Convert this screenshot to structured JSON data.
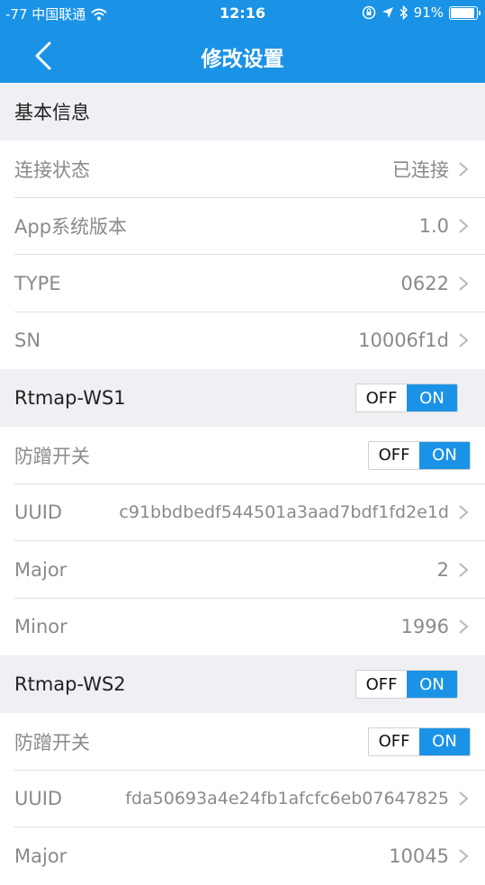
{
  "status_bar": {
    "carrier": "-77 中国联通",
    "time": "12:16",
    "battery": "91%"
  },
  "nav": {
    "title": "修改设置"
  },
  "sections": {
    "basic": "基本信息",
    "ws1": "Rtmap-WS1",
    "ws2": "Rtmap-WS2"
  },
  "basic_rows": {
    "connection": {
      "label": "连接状态",
      "value": "已连接"
    },
    "app_version": {
      "label": "App系统版本",
      "value": "1.0"
    },
    "type": {
      "label": "TYPE",
      "value": "0622"
    },
    "sn": {
      "label": "SN",
      "value": "10006f1d"
    }
  },
  "toggle": {
    "off": "OFF",
    "on": "ON"
  },
  "ws1": {
    "tamper_label": "防蹭开关",
    "uuid_label": "UUID",
    "uuid_value": "c91bbdbedf544501a3aad7bdf1fd2e1d",
    "major_label": "Major",
    "major_value": "2",
    "minor_label": "Minor",
    "minor_value": "1996"
  },
  "ws2": {
    "tamper_label": "防蹭开关",
    "uuid_label": "UUID",
    "uuid_value": "fda50693a4e24fb1afcfc6eb07647825",
    "major_label": "Major",
    "major_value": "10045"
  },
  "icons": {
    "back": "chevron-left-icon",
    "row_arrow": "chevron-right-icon",
    "wifi": "wifi-icon",
    "lock": "orientation-lock-icon",
    "location": "location-arrow-icon",
    "bluetooth": "bluetooth-icon",
    "battery": "battery-icon"
  },
  "colors": {
    "accent": "#1a93e6",
    "section_bg": "#efeff4",
    "secondary_text": "#8a8a8a"
  }
}
